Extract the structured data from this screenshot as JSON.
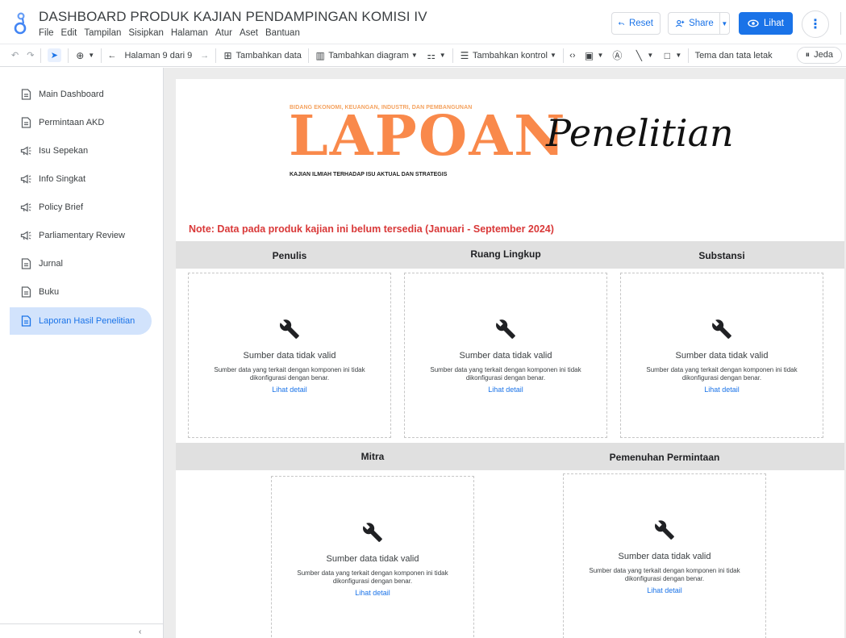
{
  "header": {
    "title": "DASHBOARD PRODUK KAJIAN PENDAMPINGAN KOMISI IV",
    "menu": [
      "File",
      "Edit",
      "Tampilan",
      "Sisipkan",
      "Halaman",
      "Atur",
      "Aset",
      "Bantuan"
    ],
    "reset_label": "Reset",
    "share_label": "Share",
    "view_label": "Lihat",
    "brand_color": "#1a73e8"
  },
  "toolbar": {
    "page_indicator": "Halaman 9 dari 9",
    "add_data": "Tambahkan data",
    "add_chart": "Tambahkan diagram",
    "add_control": "Tambahkan kontrol",
    "theme": "Tema dan tata letak",
    "pause": "Jeda"
  },
  "sidebar": {
    "items": [
      {
        "label": "Main Dashboard",
        "icon": "doc-icon"
      },
      {
        "label": "Permintaan AKD",
        "icon": "doc-icon"
      },
      {
        "label": "Isu Sepekan",
        "icon": "megaphone-icon"
      },
      {
        "label": "Info Singkat",
        "icon": "megaphone-icon"
      },
      {
        "label": "Policy Brief",
        "icon": "megaphone-icon"
      },
      {
        "label": "Parliamentary Review",
        "icon": "megaphone-icon"
      },
      {
        "label": "Jurnal",
        "icon": "doc-icon"
      },
      {
        "label": "Buku",
        "icon": "doc-icon"
      },
      {
        "label": "Laporan Hasil Penelitian",
        "icon": "doc-icon",
        "active": true
      }
    ]
  },
  "report": {
    "banner": {
      "subtitle": "BIDANG EKONOMI, KEUANGAN, INDUSTRI, DAN PEMBANGUNAN",
      "word1": "LAPOAN",
      "word2": "Penelitian",
      "tagline": "KAJIAN ILMIAH TERHADAP ISU AKTUAL DAN STRATEGIS",
      "accent_color": "#f9894b"
    },
    "note": "Note: Data pada produk kajian ini belum tersedia (Januari - September 2024)",
    "sections": {
      "penulis": "Penulis",
      "ruang_lingkup": "Ruang Lingkup",
      "substansi": "Substansi",
      "mitra": "Mitra",
      "pemenuhan": "Pemenuhan Permintaan"
    },
    "widget": {
      "error_title": "Sumber data tidak valid",
      "error_desc": "Sumber data yang terkait dengan komponen ini tidak dikonfigurasi dengan benar.",
      "detail_link": "Lihat detail"
    }
  }
}
